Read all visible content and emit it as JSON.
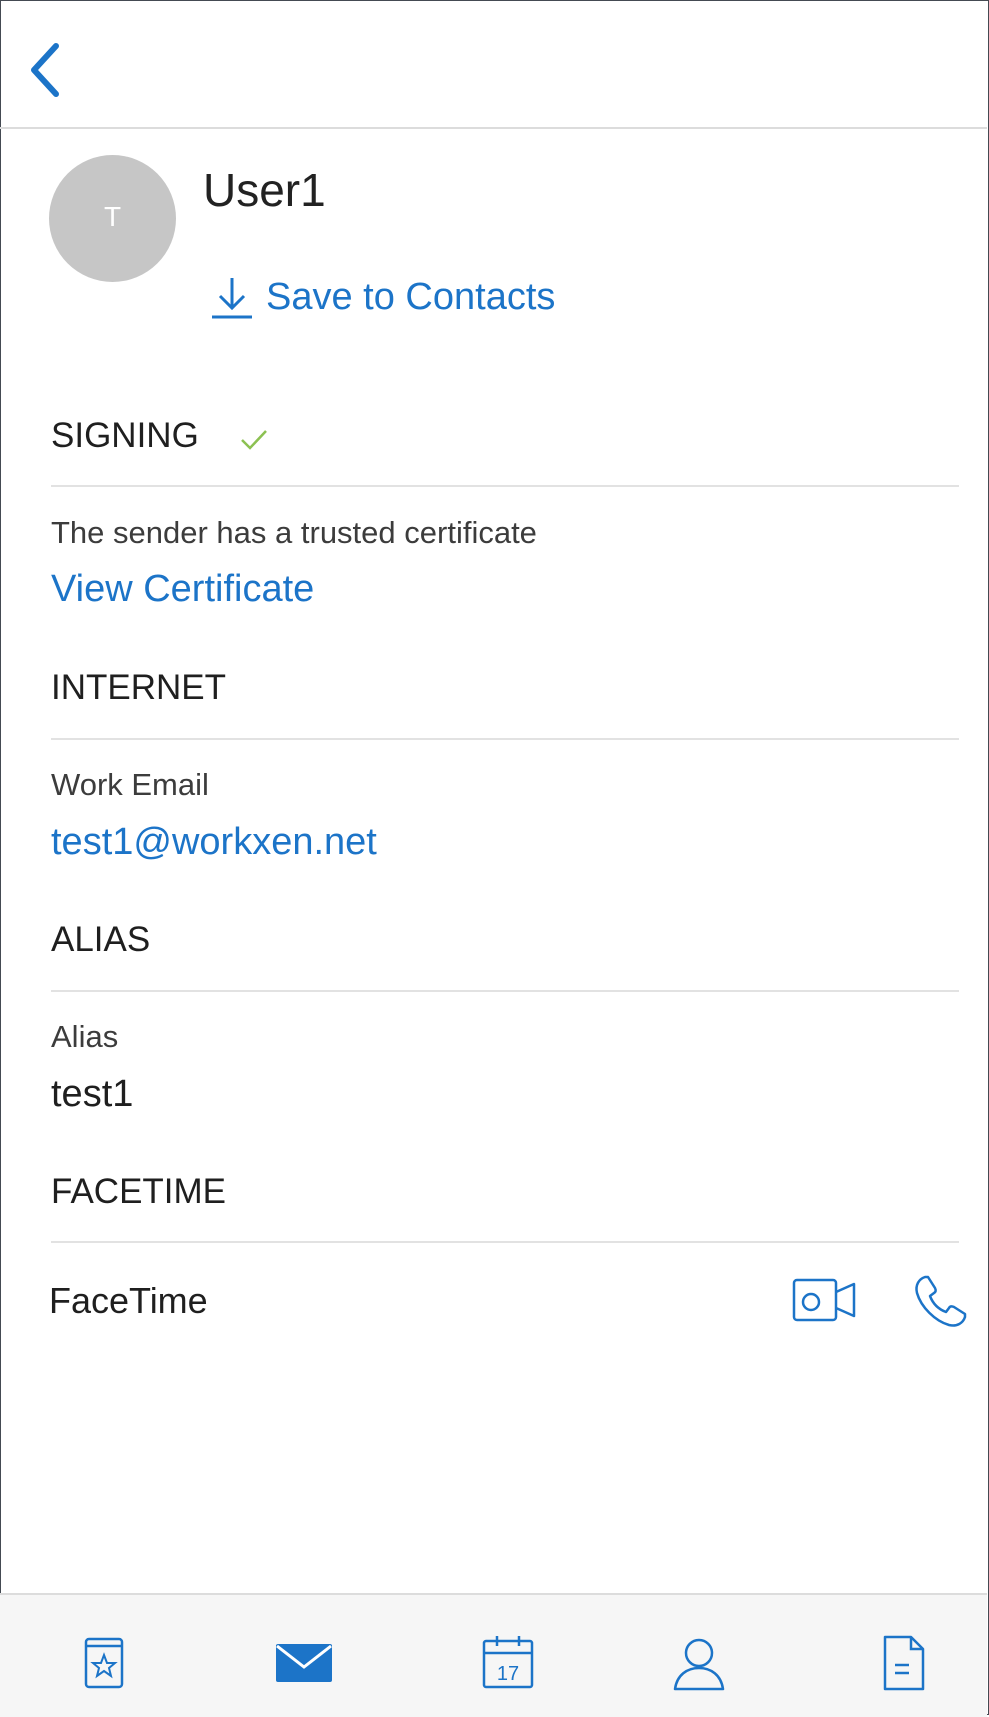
{
  "profile": {
    "avatar_initial": "T",
    "name": "User1",
    "save_label": "Save to Contacts"
  },
  "signing": {
    "header": "SIGNING",
    "status_text": "The sender has a trusted certificate",
    "link_label": "View Certificate"
  },
  "internet": {
    "header": "INTERNET",
    "field_label": "Work Email",
    "email": "test1@workxen.net"
  },
  "alias": {
    "header": "ALIAS",
    "field_label": "Alias",
    "value": "test1"
  },
  "facetime": {
    "header": "FACETIME",
    "label": "FaceTime"
  },
  "tabbar": {
    "calendar_day": "17",
    "icons": [
      "favorites-icon",
      "mail-icon",
      "calendar-icon",
      "contacts-icon",
      "files-icon"
    ],
    "selected": "mail-icon"
  },
  "colors": {
    "accent": "#1c74c8",
    "check": "#8cc152",
    "avatar": "#c6c6c6"
  }
}
